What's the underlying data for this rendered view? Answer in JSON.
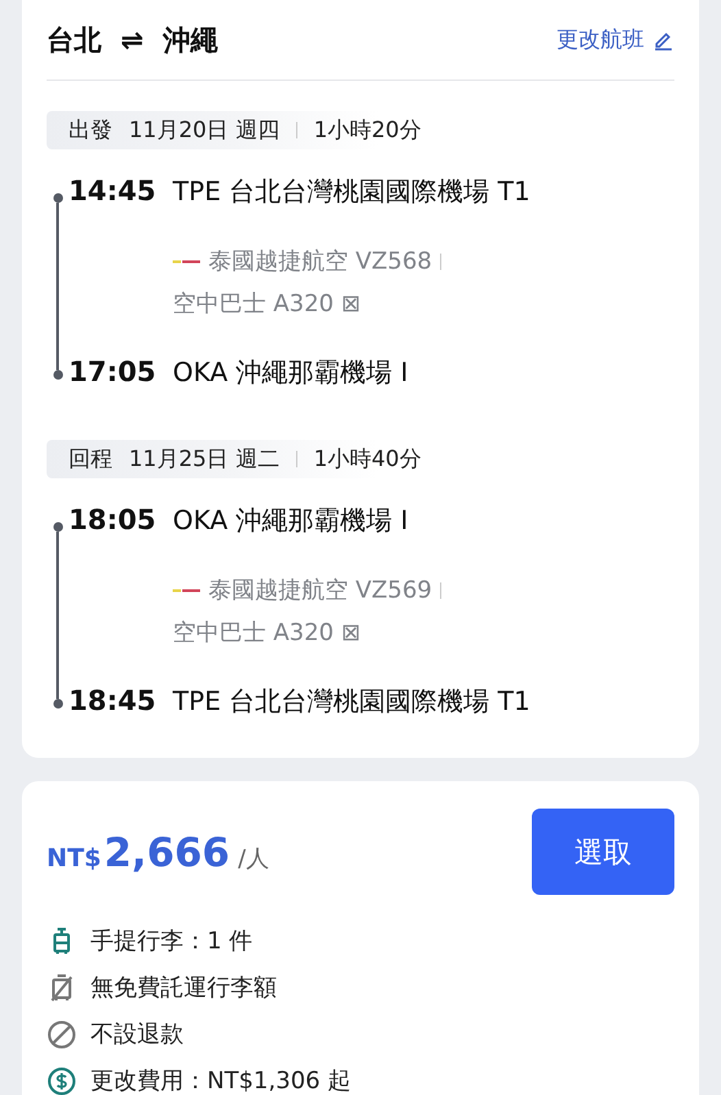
{
  "route": {
    "from": "台北",
    "arrow": "⇌",
    "to": "沖繩"
  },
  "change_link": "更改航班",
  "legs": [
    {
      "label": "出發",
      "date": "11月20日 週四",
      "duration": "1小時20分",
      "departure": {
        "time": "14:45",
        "airport": "TPE 台北台灣桃園國際機場 T1"
      },
      "airline": "泰國越捷航空 VZ568",
      "aircraft": "空中巴士 A320 ⊠",
      "arrival": {
        "time": "17:05",
        "airport": "OKA 沖繩那霸機場 I"
      }
    },
    {
      "label": "回程",
      "date": "11月25日 週二",
      "duration": "1小時40分",
      "departure": {
        "time": "18:05",
        "airport": "OKA 沖繩那霸機場 I"
      },
      "airline": "泰國越捷航空 VZ569",
      "aircraft": "空中巴士 A320 ⊠",
      "arrival": {
        "time": "18:45",
        "airport": "TPE 台北台灣桃園國際機場 T1"
      }
    }
  ],
  "price": {
    "currency": "NT$",
    "amount": "2,666",
    "unit": "/人"
  },
  "select_button": "選取",
  "features": [
    {
      "kind": "carry_on",
      "text": "手提行李：1 件"
    },
    {
      "kind": "no_checked",
      "text": "無免費託運行李額"
    },
    {
      "kind": "no_refund",
      "text": "不設退款"
    },
    {
      "kind": "change_fee",
      "text": "更改費用：NT$1,306 起"
    }
  ]
}
